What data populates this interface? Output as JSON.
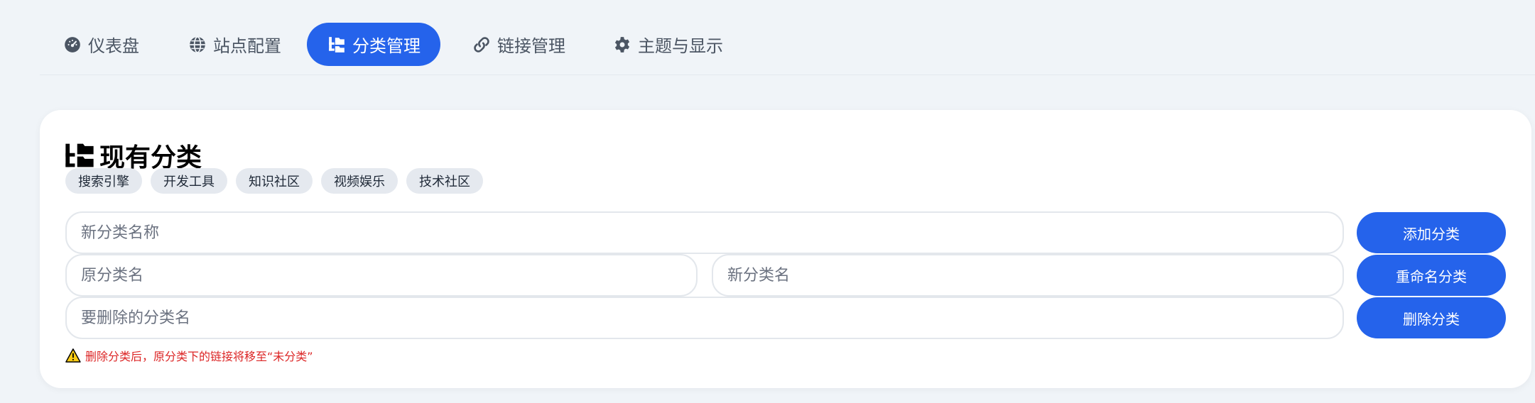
{
  "nav": {
    "tabs": [
      {
        "label": "仪表盘",
        "icon": "gauge-icon"
      },
      {
        "label": "站点配置",
        "icon": "globe-icon"
      },
      {
        "label": "分类管理",
        "icon": "folder-tree-icon",
        "active": true
      },
      {
        "label": "链接管理",
        "icon": "link-icon"
      },
      {
        "label": "主题与显示",
        "icon": "gear-icon"
      }
    ]
  },
  "card": {
    "title": "现有分类",
    "title_icon": "folder-tree-icon",
    "categories": [
      "搜索引擎",
      "开发工具",
      "知识社区",
      "视频娱乐",
      "技术社区"
    ],
    "add": {
      "placeholder": "新分类名称",
      "button": "添加分类"
    },
    "rename": {
      "old_placeholder": "原分类名",
      "new_placeholder": "新分类名",
      "button": "重命名分类"
    },
    "delete": {
      "placeholder": "要删除的分类名",
      "button": "删除分类"
    },
    "warning": "删除分类后，原分类下的链接将移至“未分类”"
  },
  "colors": {
    "accent": "#2563eb",
    "background": "#f0f4f8",
    "chip_bg": "#e5e9ef",
    "warning": "#dc2626"
  }
}
